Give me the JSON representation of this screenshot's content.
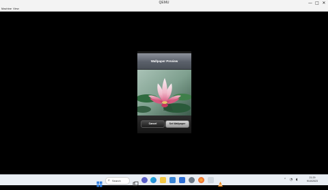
{
  "window": {
    "title": "QEMU",
    "controls": {
      "minimize": "—",
      "maximize": "□",
      "close": "✕"
    }
  },
  "menu": {
    "items": [
      "Machine",
      "View"
    ]
  },
  "wallpaper_preview": {
    "title": "Wallpaper Preview",
    "cancel_label": "Cancel",
    "set_label": "Set Wallpaper"
  },
  "taskbar": {
    "search_label": "Search",
    "apps": [
      "start-icon",
      "task-view-icon",
      "chat-icon",
      "edge-icon",
      "file-explorer-icon",
      "store-icon",
      "mail-icon",
      "settings-icon",
      "firefox-icon",
      "app-icon",
      "vlc-icon"
    ],
    "clock": {
      "time": "21:29",
      "date": "9/10/2023"
    }
  },
  "colors": {
    "accent": "#2f7ee0",
    "nav_bar": "#6b7079",
    "background": "#000000"
  }
}
